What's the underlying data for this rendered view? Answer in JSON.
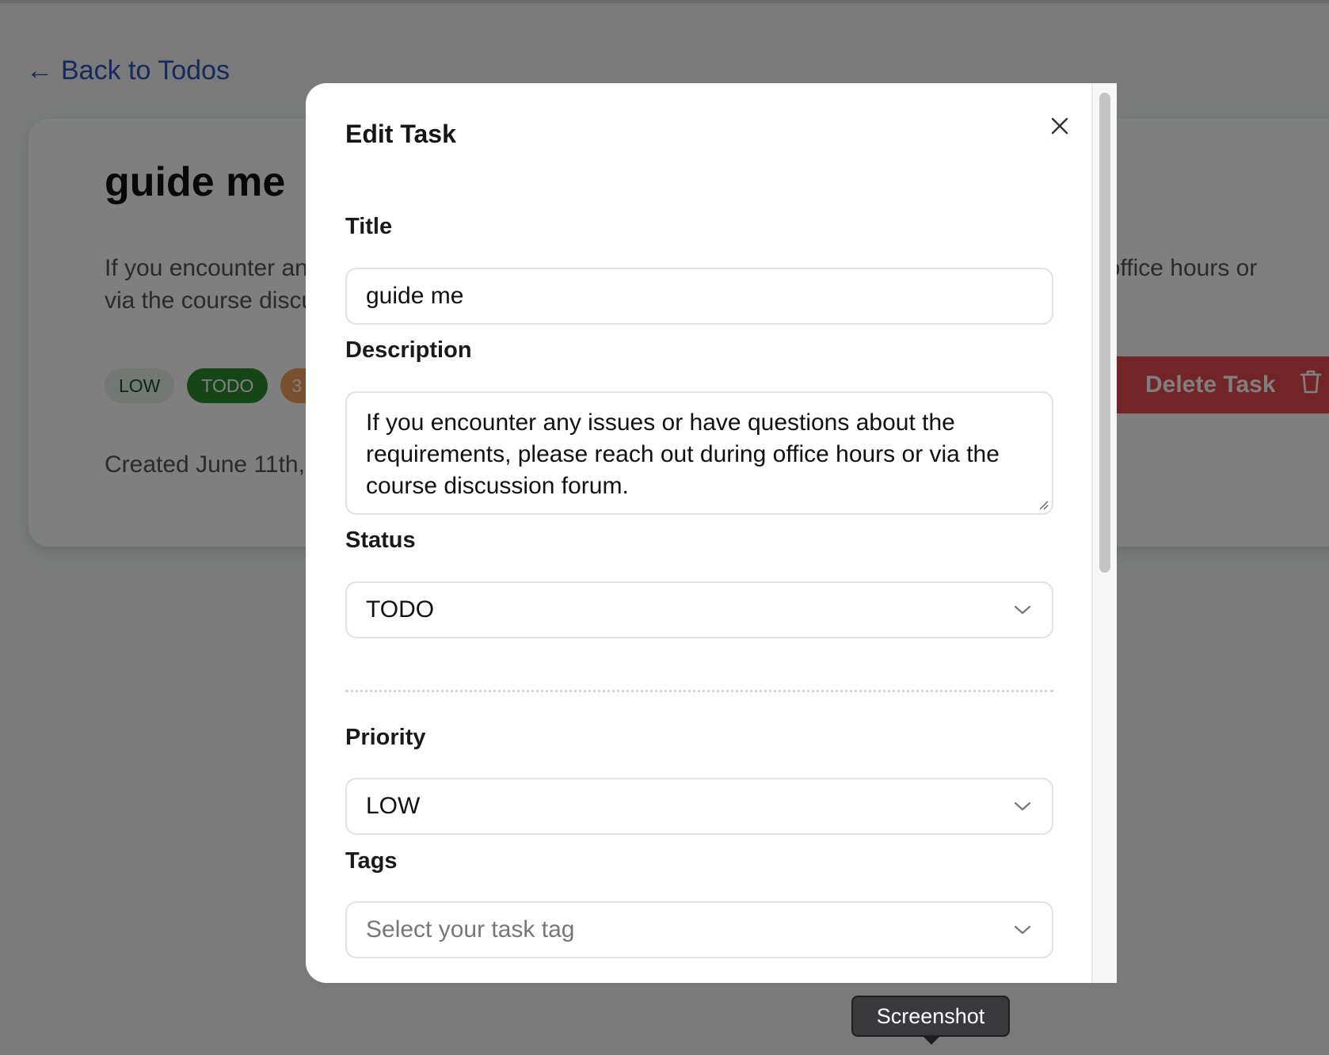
{
  "background": {
    "back_link": "Back to Todos",
    "task": {
      "title": "guide me",
      "description": "If you encounter any issues or have questions about the requirements, please reach out during office hours or via the course discussion forum.",
      "badges": {
        "priority": "LOW",
        "status": "TODO",
        "extra": "3"
      },
      "created": "Created June 11th,",
      "delete_label": "Delete Task"
    }
  },
  "modal": {
    "title": "Edit Task",
    "fields": {
      "title_label": "Title",
      "title_value": "guide me",
      "description_label": "Description",
      "description_value": "If you encounter any issues or have questions about the requirements, please reach out during office hours or via the course discussion forum.",
      "status_label": "Status",
      "status_value": "TODO",
      "priority_label": "Priority",
      "priority_value": "LOW",
      "tags_label": "Tags",
      "tags_placeholder": "Select your task tag"
    }
  },
  "tooltip": {
    "label": "Screenshot"
  },
  "colors": {
    "link": "#2a53b8",
    "delete": "#e5484d",
    "badge_todo": "#2c8a2e",
    "badge_low_bg": "#e4f1e6",
    "overlay": "rgba(0,0,0,0.5)"
  },
  "icons": {
    "back": "arrow-left-icon",
    "close": "close-icon",
    "delete": "trash-icon",
    "dropdown": "chevron-down-icon"
  }
}
